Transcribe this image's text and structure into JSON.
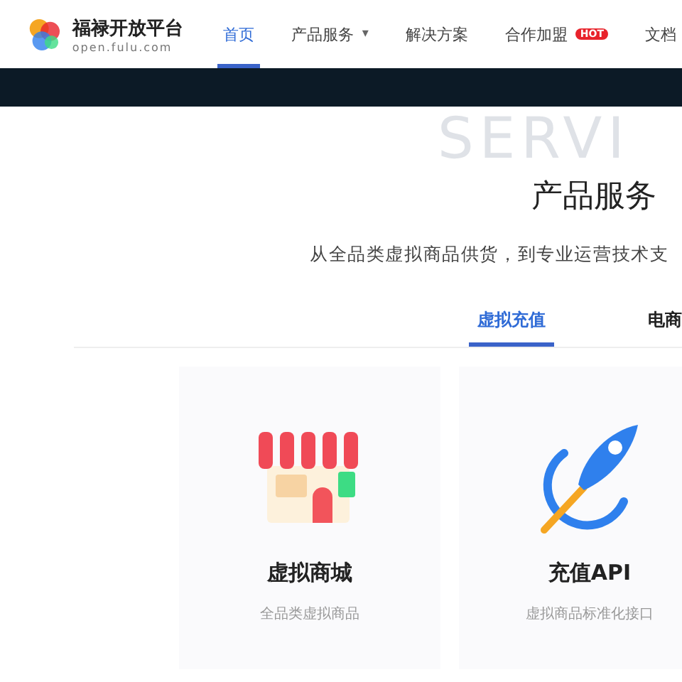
{
  "header": {
    "brand": {
      "name": "福禄开放平台",
      "domain": "open.fulu.com"
    },
    "nav": [
      {
        "label": "首页",
        "selected": true,
        "kind": "link"
      },
      {
        "label": "产品服务",
        "selected": false,
        "kind": "dropdown",
        "caret": "▾"
      },
      {
        "label": "解决方案",
        "selected": false,
        "kind": "link"
      },
      {
        "label": "合作加盟",
        "selected": false,
        "kind": "badge",
        "badge": "HOT"
      },
      {
        "label": "文档",
        "selected": false,
        "kind": "link"
      }
    ]
  },
  "section": {
    "background_word": "SERVI",
    "title": "产品服务",
    "subtitle": "从全品类虚拟商品供货，到专业运营技术支",
    "tabs": [
      {
        "label": "虚拟充值",
        "selected": true
      },
      {
        "label": "电商",
        "selected": false
      }
    ],
    "cards": [
      {
        "kind": "shop",
        "title": "虚拟商城",
        "description": "全品类虚拟商品"
      },
      {
        "kind": "rocket",
        "title": "充值API",
        "description": "虚拟商品标准化接口"
      }
    ]
  }
}
